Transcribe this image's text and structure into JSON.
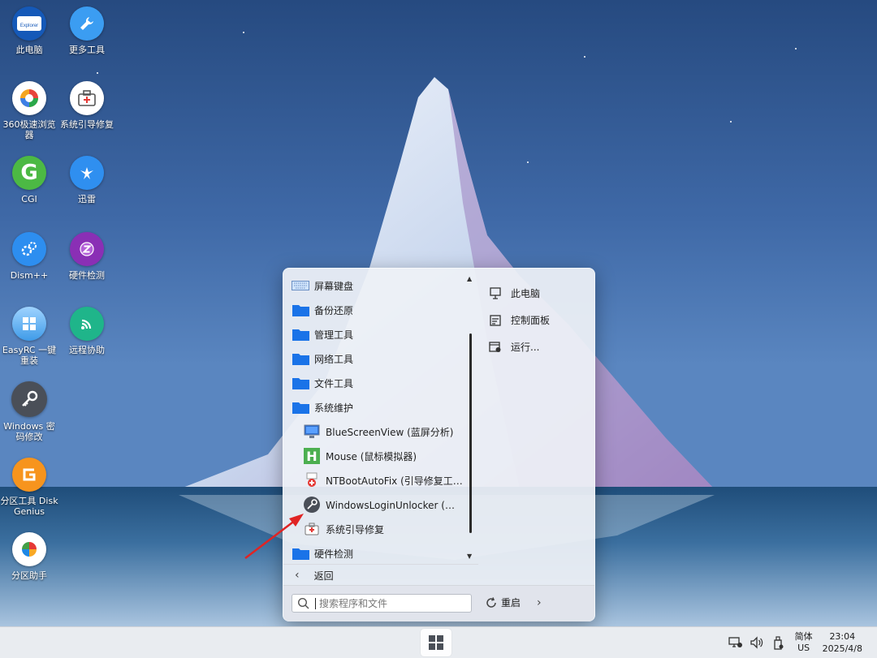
{
  "desktop": {
    "icons": [
      {
        "label": "此电脑",
        "icon": "explorer-icon",
        "badge": "Explorer"
      },
      {
        "label": "更多工具",
        "icon": "wrench-icon"
      },
      {
        "label": "360极速浏览器",
        "icon": "browser-360-icon"
      },
      {
        "label": "系统引导修复",
        "icon": "toolbox-icon"
      },
      {
        "label": "CGI",
        "icon": "cgi-icon",
        "glyph": "G"
      },
      {
        "label": "迅雷",
        "icon": "xunlei-icon"
      },
      {
        "label": "Dism++",
        "icon": "dism-icon"
      },
      {
        "label": "硬件检测",
        "icon": "hardware-icon"
      },
      {
        "label": "EasyRC 一键重装",
        "icon": "windows-icon"
      },
      {
        "label": "远程协助",
        "icon": "remote-assist-icon"
      },
      {
        "label": "Windows 密码修改",
        "icon": "key-icon"
      },
      {
        "label": "分区工具 DiskGenius",
        "icon": "diskgenius-icon"
      },
      {
        "label": "分区助手",
        "icon": "partition-assistant-icon"
      }
    ]
  },
  "start_menu": {
    "programs": [
      {
        "label": "屏幕键盘",
        "icon": "keyboard-icon",
        "level": 0
      },
      {
        "label": "备份还原",
        "icon": "folder-icon",
        "level": 0
      },
      {
        "label": "管理工具",
        "icon": "folder-icon",
        "level": 0
      },
      {
        "label": "网络工具",
        "icon": "folder-icon",
        "level": 0
      },
      {
        "label": "文件工具",
        "icon": "folder-icon",
        "level": 0
      },
      {
        "label": "系统维护",
        "icon": "folder-icon",
        "level": 0
      },
      {
        "label": "BlueScreenView (蓝屏分析)",
        "icon": "monitor-icon",
        "level": 1
      },
      {
        "label": "Mouse (鼠标模拟器)",
        "icon": "h-icon",
        "level": 1
      },
      {
        "label": "NTBootAutoFix (引导修复工具)",
        "icon": "bootfix-icon",
        "level": 1
      },
      {
        "label": "WindowsLoginUnlocker (密码...",
        "icon": "key-icon",
        "level": 1
      },
      {
        "label": "系统引导修复",
        "icon": "toolbox-icon",
        "level": 1
      },
      {
        "label": "硬件检测",
        "icon": "folder-icon",
        "level": 0
      }
    ],
    "back_label": "返回",
    "right_items": [
      {
        "label": "此电脑",
        "icon": "computer-icon"
      },
      {
        "label": "控制面板",
        "icon": "control-panel-icon"
      },
      {
        "label": "运行...",
        "icon": "run-icon"
      }
    ],
    "search": {
      "placeholder": "搜索程序和文件",
      "value": ""
    },
    "restart_label": "重启"
  },
  "taskbar": {
    "ime_line1": "简体",
    "ime_line2": "US",
    "time": "23:04",
    "date": "2025/4/8"
  },
  "colors": {
    "folder": "#1a73e8",
    "accent": "#2b6fd6",
    "annotation_arrow": "#e02424"
  }
}
